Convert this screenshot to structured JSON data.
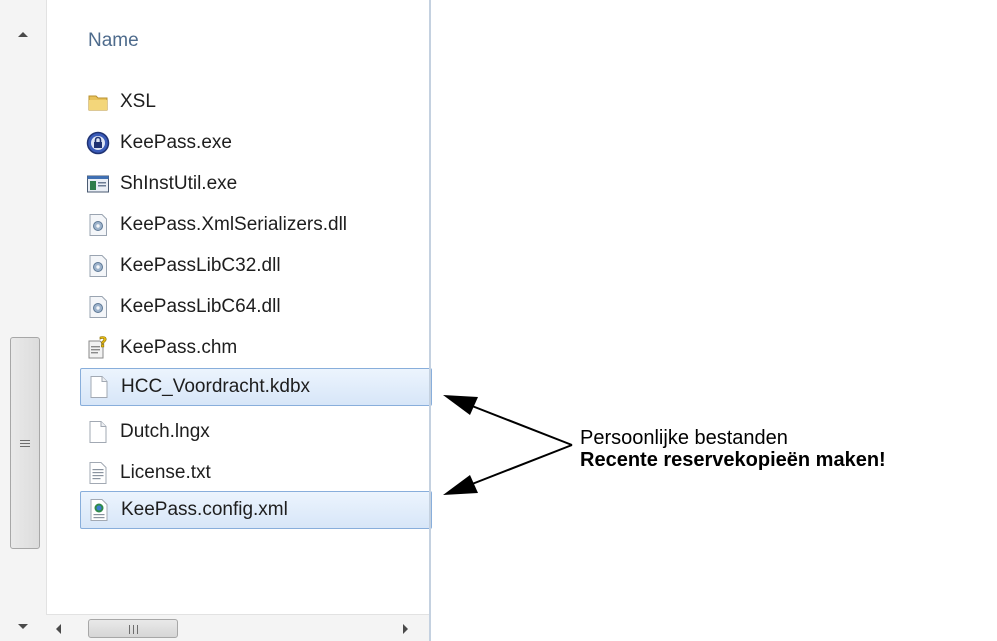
{
  "explorer": {
    "column_header": "Name",
    "files": [
      {
        "name": "XSL",
        "icon": "folder-icon",
        "selected": false
      },
      {
        "name": "KeePass.exe",
        "icon": "keepass-app-icon",
        "selected": false
      },
      {
        "name": "ShInstUtil.exe",
        "icon": "exe-window-icon",
        "selected": false
      },
      {
        "name": "KeePass.XmlSerializers.dll",
        "icon": "dll-icon",
        "selected": false
      },
      {
        "name": "KeePassLibC32.dll",
        "icon": "dll-icon",
        "selected": false
      },
      {
        "name": "KeePassLibC64.dll",
        "icon": "dll-icon",
        "selected": false
      },
      {
        "name": "KeePass.chm",
        "icon": "help-file-icon",
        "selected": false
      },
      {
        "name": "HCC_Voordracht.kdbx",
        "icon": "blank-file-icon",
        "selected": true
      },
      {
        "name": "Dutch.lngx",
        "icon": "blank-file-icon",
        "selected": false
      },
      {
        "name": "License.txt",
        "icon": "text-file-icon",
        "selected": false
      },
      {
        "name": "KeePass.config.xml",
        "icon": "xml-file-icon",
        "selected": true
      }
    ]
  },
  "annotation": {
    "line1": "Persoonlijke bestanden",
    "line2": "Recente reservekopieën maken!"
  },
  "colors": {
    "selection_border": "#88aedb",
    "header_text": "#4e6b8c"
  }
}
